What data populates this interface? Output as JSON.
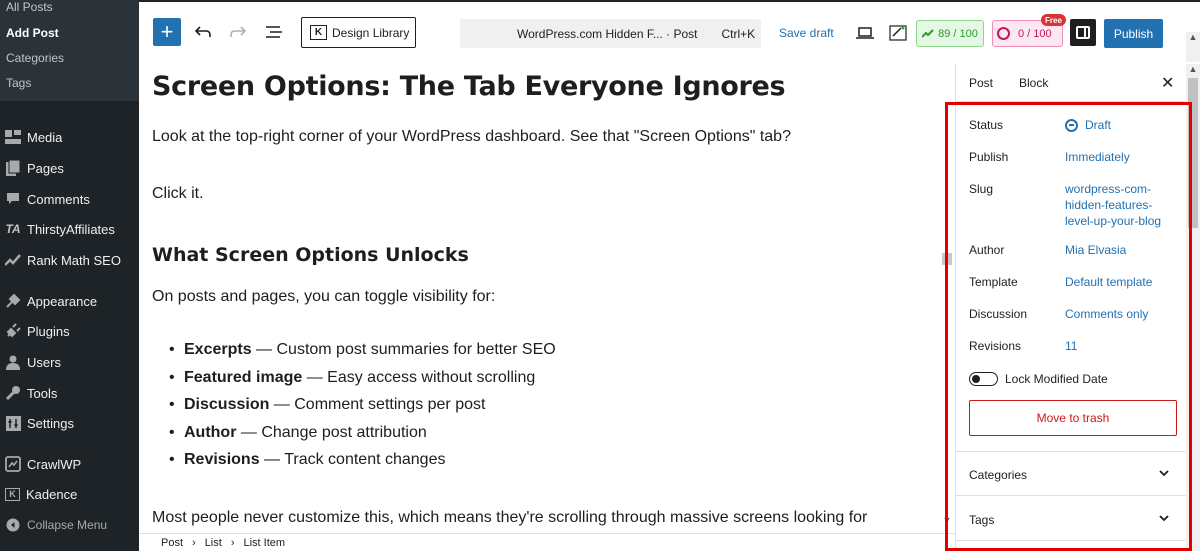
{
  "admin_menu": {
    "submenu": [
      {
        "label": "All Posts"
      },
      {
        "label": "Add Post"
      },
      {
        "label": "Categories"
      },
      {
        "label": "Tags"
      }
    ],
    "items": [
      {
        "label": "Media",
        "icon": "media-icon"
      },
      {
        "label": "Pages",
        "icon": "pages-icon"
      },
      {
        "label": "Comments",
        "icon": "comments-icon"
      },
      {
        "label": "ThirstyAffiliates",
        "icon": "thirstyaffiliates-icon",
        "glyph": "TA"
      },
      {
        "label": "Rank Math SEO",
        "icon": "rank-math-icon"
      },
      {
        "label": "Appearance",
        "icon": "appearance-icon"
      },
      {
        "label": "Plugins",
        "icon": "plugins-icon"
      },
      {
        "label": "Users",
        "icon": "users-icon"
      },
      {
        "label": "Tools",
        "icon": "tools-icon"
      },
      {
        "label": "Settings",
        "icon": "settings-icon"
      },
      {
        "label": "CrawlWP",
        "icon": "crawlwp-icon"
      },
      {
        "label": "Kadence",
        "icon": "kadence-icon",
        "glyph": "K"
      },
      {
        "label": "Collapse Menu",
        "icon": "collapse-icon"
      }
    ]
  },
  "toolbar": {
    "design_library": "Design Library",
    "design_library_glyph": "K",
    "command_title": "WordPress.com Hidden F... · Post",
    "command_shortcut": "Ctrl+K",
    "save_draft": "Save draft",
    "seo_score": "89 / 100",
    "readability_score": "0 / 100",
    "free_badge": "Free",
    "publish": "Publish"
  },
  "content": {
    "title": "Screen Options: The Tab Everyone Ignores",
    "p1": "Look at the top-right corner of your WordPress dashboard. See that \"Screen Options\" tab?",
    "p2": "Click it.",
    "h2": "What Screen Options Unlocks",
    "p3": "On posts and pages, you can toggle visibility for:",
    "list": [
      {
        "bold": "Excerpts",
        "rest": " — Custom post summaries for better SEO"
      },
      {
        "bold": "Featured image",
        "rest": " — Easy access without scrolling"
      },
      {
        "bold": "Discussion",
        "rest": " — Comment settings per post"
      },
      {
        "bold": "Author",
        "rest": " — Change post attribution"
      },
      {
        "bold": "Revisions",
        "rest": " — Track content changes"
      }
    ],
    "p4": "Most people never customize this, which means they're scrolling through massive screens looking for"
  },
  "breadcrumb": [
    "Post",
    "List",
    "List Item"
  ],
  "sidebar": {
    "tabs": [
      "Post",
      "Block"
    ],
    "rows": {
      "status_label": "Status",
      "status_value": "Draft",
      "publish_label": "Publish",
      "publish_value": "Immediately",
      "slug_label": "Slug",
      "slug_value": "wordpress-com-hidden-features-level-up-your-blog",
      "author_label": "Author",
      "author_value": "Mia Elvasia",
      "template_label": "Template",
      "template_value": "Default template",
      "discussion_label": "Discussion",
      "discussion_value": "Comments only",
      "revisions_label": "Revisions",
      "revisions_value": "11"
    },
    "lock_modified_date": "Lock Modified Date",
    "lock_modified_enabled": false,
    "move_to_trash": "Move to trash",
    "panels": [
      "Categories",
      "Tags"
    ]
  },
  "colors": {
    "accent": "#2271b1",
    "admin_bg": "#1d2327",
    "highlight": "#e00000",
    "danger": "#cc1818"
  }
}
